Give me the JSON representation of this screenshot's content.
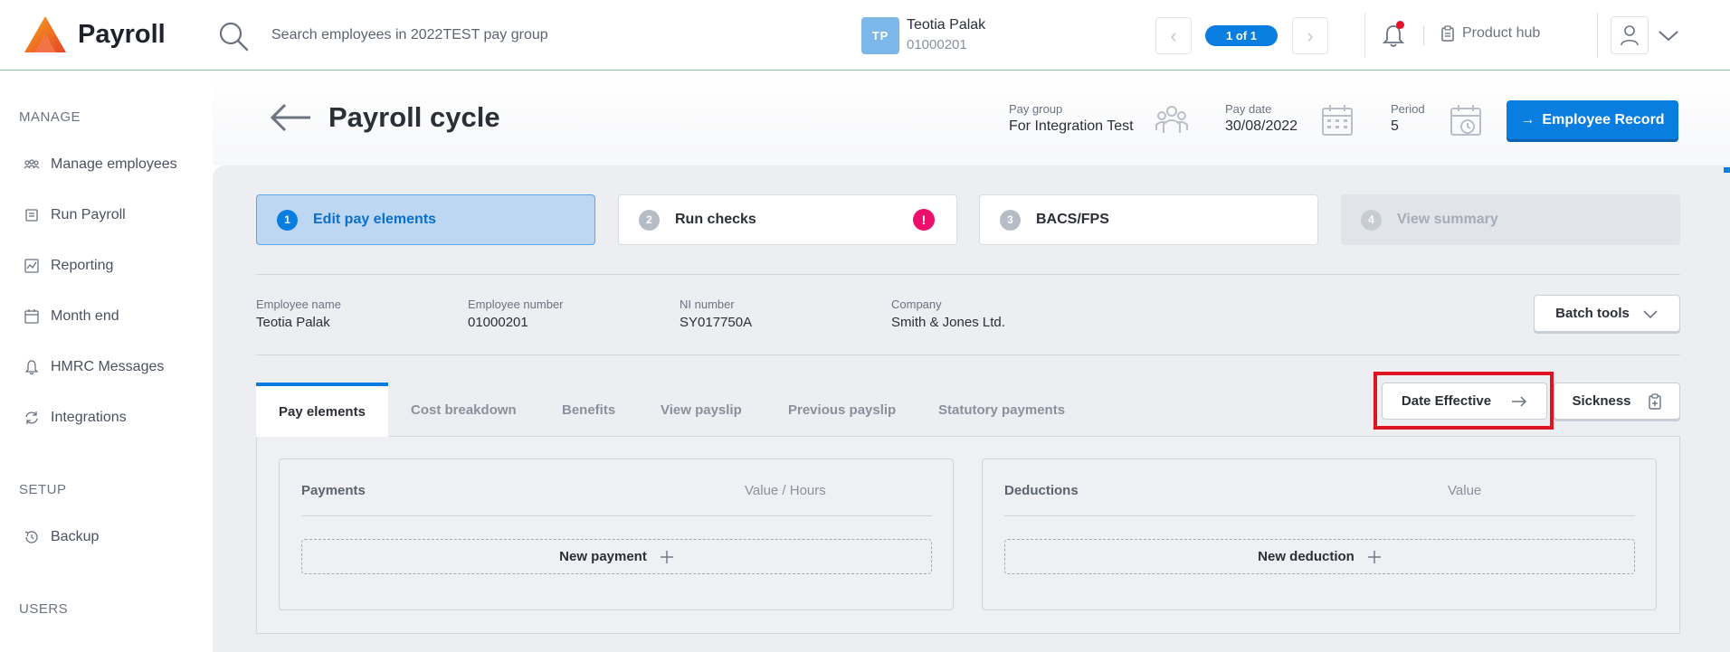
{
  "app": {
    "title": "Payroll"
  },
  "search": {
    "placeholder": "Search employees in 2022TEST pay group"
  },
  "employee_switcher": {
    "initials": "TP",
    "name": "Teotia Palak",
    "number": "01000201",
    "pager": "1 of 1"
  },
  "header_right": {
    "product_hub": "Product hub"
  },
  "sidebar": {
    "manage_heading": "MANAGE",
    "manage_items": [
      "Manage employees",
      "Run Payroll",
      "Reporting",
      "Month end",
      "HMRC Messages",
      "Integrations"
    ],
    "setup_heading": "SETUP",
    "setup_items": [
      "Backup"
    ],
    "users_heading": "USERS"
  },
  "page": {
    "title": "Payroll cycle",
    "pay_group_label": "Pay group",
    "pay_group_value": "For Integration Test",
    "pay_date_label": "Pay date",
    "pay_date_value": "30/08/2022",
    "period_label": "Period",
    "period_value": "5",
    "employee_record_button": "Employee Record"
  },
  "steps": [
    {
      "num": "1",
      "label": "Edit pay elements",
      "state": "active"
    },
    {
      "num": "2",
      "label": "Run checks",
      "state": "normal",
      "warning": "!"
    },
    {
      "num": "3",
      "label": "BACS/FPS",
      "state": "normal"
    },
    {
      "num": "4",
      "label": "View summary",
      "state": "disabled"
    }
  ],
  "employee_info": {
    "name_label": "Employee name",
    "name_value": "Teotia Palak",
    "number_label": "Employee number",
    "number_value": "01000201",
    "ni_label": "NI number",
    "ni_value": "SY017750A",
    "company_label": "Company",
    "company_value": "Smith & Jones Ltd.",
    "batch_tools": "Batch tools"
  },
  "tabs": [
    "Pay elements",
    "Cost breakdown",
    "Benefits",
    "View payslip",
    "Previous payslip",
    "Statutory payments"
  ],
  "actions": {
    "date_effective": "Date Effective",
    "sickness": "Sickness"
  },
  "payments_card": {
    "title": "Payments",
    "column": "Value / Hours",
    "new_button": "New payment"
  },
  "deductions_card": {
    "title": "Deductions",
    "column": "Value",
    "new_button": "New deduction"
  },
  "colors": {
    "accent": "#0a7de0",
    "warning": "#ec0f6c",
    "highlight": "#e0141f",
    "brand_orange": "#f5871f"
  }
}
